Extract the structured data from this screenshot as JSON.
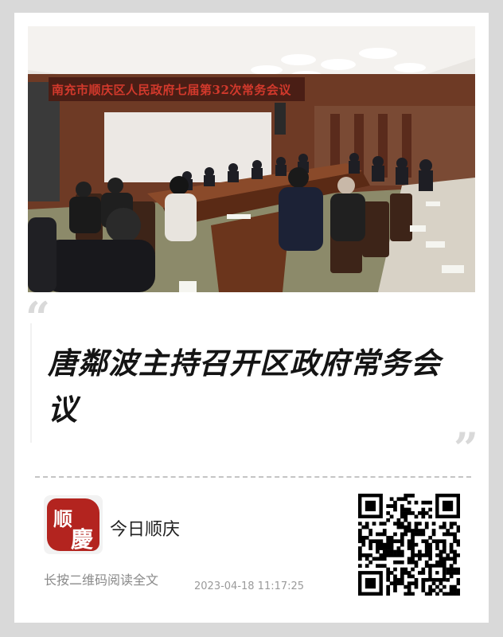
{
  "photo": {
    "banner_text": "南充市顺庆区人民政府七届第32次常务会议",
    "alt": "meeting-photo"
  },
  "article": {
    "quote_open": "“",
    "quote_close": "”",
    "title": "唐鄰波主持召开区政府常务会议"
  },
  "footer": {
    "logo_chars": [
      "顺",
      "慶"
    ],
    "account_name": "今日顺庆",
    "hint": "长按二维码阅读全文",
    "timestamp": "2023-04-18 11:17:25"
  },
  "colors": {
    "background": "#d9d9d9",
    "card": "#ffffff",
    "logo_red": "#b3241f",
    "banner_red": "#d2392c",
    "title": "#141414"
  }
}
